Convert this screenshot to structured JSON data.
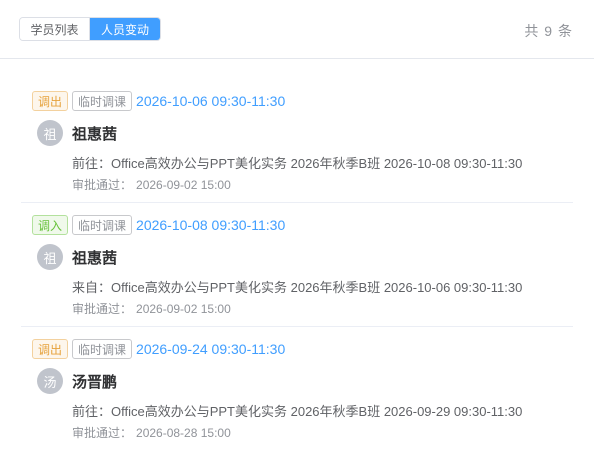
{
  "header": {
    "tabs": [
      {
        "label": "学员列表",
        "active": false
      },
      {
        "label": "人员变动",
        "active": true
      }
    ],
    "total_text": "共 9 条"
  },
  "colors": {
    "primary": "#409eff",
    "warning": "#e6a23c",
    "success": "#67c23a",
    "info": "#909399"
  },
  "records": [
    {
      "type_tag": "调出",
      "type_color": "warning",
      "mode_tag": "临时调课",
      "time": "2026-10-06 09:30-11:30",
      "avatar_char": "祖",
      "name": "祖惠茜",
      "detail": "前往：Office高效办公与PPT美化实务 2026年秋季B班 2026-10-08 09:30-11:30",
      "approve_label": "审批通过：",
      "approve_time": "2026-09-02 15:00"
    },
    {
      "type_tag": "调入",
      "type_color": "success",
      "mode_tag": "临时调课",
      "time": "2026-10-08 09:30-11:30",
      "avatar_char": "祖",
      "name": "祖惠茜",
      "detail": "来自：Office高效办公与PPT美化实务 2026年秋季B班 2026-10-06 09:30-11:30",
      "approve_label": "审批通过：",
      "approve_time": "2026-09-02 15:00"
    },
    {
      "type_tag": "调出",
      "type_color": "warning",
      "mode_tag": "临时调课",
      "time": "2026-09-24 09:30-11:30",
      "avatar_char": "汤",
      "name": "汤晋鹏",
      "detail": "前往：Office高效办公与PPT美化实务 2026年秋季B班 2026-09-29 09:30-11:30",
      "approve_label": "审批通过：",
      "approve_time": "2026-08-28 15:00"
    }
  ]
}
